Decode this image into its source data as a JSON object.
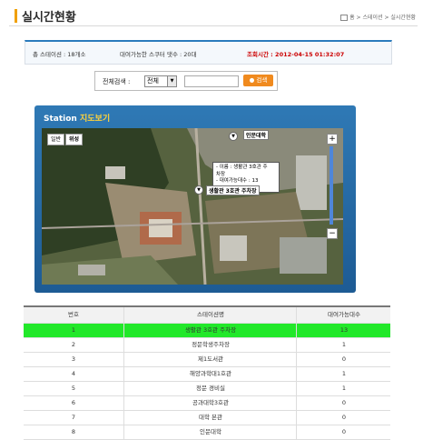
{
  "page": {
    "title": "실시간현황"
  },
  "breadcrumb": [
    "홈",
    "스테이션",
    "실시간현황"
  ],
  "summary": {
    "total": "총 스테이션 : 18개소",
    "available": "대여가능한 스쿠터 댓수 : 20대",
    "time": "조회시간 : 2012-04-15 01:32:07"
  },
  "search": {
    "label": "전체검색 :",
    "select_value": "전체",
    "button": "검색"
  },
  "map": {
    "title_a": "Station",
    "title_b": "지도보기",
    "types": [
      "일반",
      "위성"
    ],
    "labels": [
      "인문대학",
      "생활관 3호관 주차장"
    ],
    "info": [
      "- 이름 : 생활관 3호관 주",
      "차장",
      "- 대여가능대수 : 13"
    ]
  },
  "table": {
    "headers": [
      "번호",
      "스테이션명",
      "대여가능대수"
    ],
    "rows": [
      [
        "1",
        "생활관 3호관 주차장",
        "13"
      ],
      [
        "2",
        "정문학생주차장",
        "1"
      ],
      [
        "3",
        "제1도서관",
        "0"
      ],
      [
        "4",
        "해양과학대1호관",
        "1"
      ],
      [
        "5",
        "정문 경비실",
        "1"
      ],
      [
        "6",
        "공과대학3호관",
        "0"
      ],
      [
        "7",
        "대학 본관",
        "0"
      ],
      [
        "8",
        "인문대학",
        "0"
      ]
    ]
  },
  "colors": {
    "highlight": "#22e82a",
    "accent": "#f08a1e",
    "time": "#cc0000"
  }
}
